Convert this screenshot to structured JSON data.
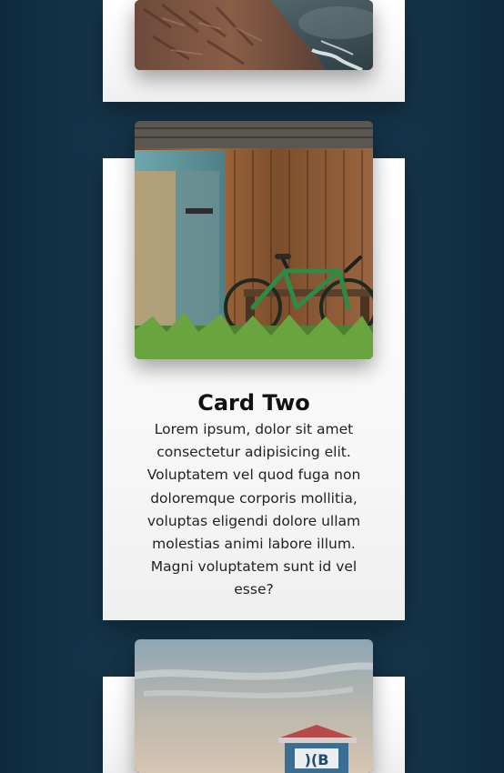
{
  "cards": [
    {
      "image_alt": "Coastal cliff and ocean",
      "title": "",
      "text": ""
    },
    {
      "image_alt": "Bicycle leaning against weathered wooden door",
      "title": "Card Two",
      "text": "Lorem ipsum, dolor sit amet consectetur adipisicing elit. Voluptatem vel quod fuga non doloremque corporis mollitia, voluptas eligendi dolore ullam molestias animi labore illum. Magni voluptatem sunt id vel esse?"
    },
    {
      "image_alt": "Lifeguard tower under cloudy sky",
      "title": "",
      "text": ""
    }
  ],
  "theme": {
    "background": "#143146",
    "card_bg": "#ffffff",
    "title_color": "#111111",
    "text_color": "#222222"
  }
}
